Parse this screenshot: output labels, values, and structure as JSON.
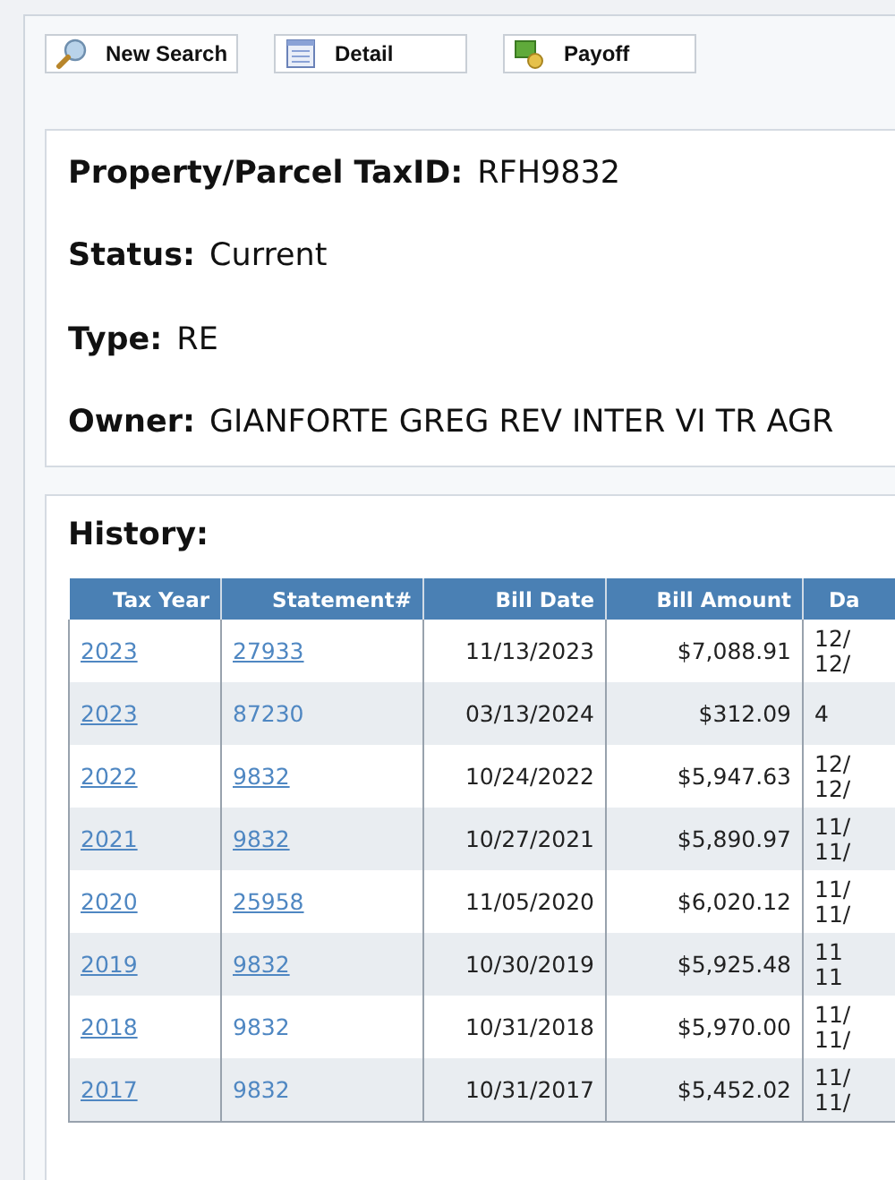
{
  "toolbar": [
    {
      "label": "New Search",
      "kind": "search"
    },
    {
      "label": "Detail",
      "kind": "detail"
    },
    {
      "label": "Payoff",
      "kind": "payoff"
    }
  ],
  "info": [
    {
      "label": "Property/Parcel TaxID:",
      "value": "RFH9832"
    },
    {
      "label": "Status:",
      "value": "Current"
    },
    {
      "label": "Type:",
      "value": "RE"
    },
    {
      "label": "Owner:",
      "value": "GIANFORTE GREG REV INTER VI TR AGR"
    }
  ],
  "history": {
    "title": "History:",
    "columns": [
      "Tax Year",
      "Statement#",
      "Bill Date",
      "Bill Amount",
      "Da"
    ],
    "rows": [
      {
        "tax_year": "2023",
        "statement": "27933",
        "statement_underlined": true,
        "bill_date": "11/13/2023",
        "bill_amount": "$7,088.91",
        "column_5": [
          "12/",
          "12/"
        ]
      },
      {
        "tax_year": "2023",
        "statement": "87230",
        "statement_underlined": false,
        "bill_date": "03/13/2024",
        "bill_amount": "$312.09",
        "column_5": [
          "4"
        ]
      },
      {
        "tax_year": "2022",
        "statement": "9832",
        "statement_underlined": true,
        "bill_date": "10/24/2022",
        "bill_amount": "$5,947.63",
        "column_5": [
          "12/",
          "12/"
        ]
      },
      {
        "tax_year": "2021",
        "statement": "9832",
        "statement_underlined": true,
        "bill_date": "10/27/2021",
        "bill_amount": "$5,890.97",
        "column_5": [
          "11/",
          "11/"
        ]
      },
      {
        "tax_year": "2020",
        "statement": "25958",
        "statement_underlined": true,
        "bill_date": "11/05/2020",
        "bill_amount": "$6,020.12",
        "column_5": [
          "11/",
          "11/"
        ]
      },
      {
        "tax_year": "2019",
        "statement": "9832",
        "statement_underlined": true,
        "bill_date": "10/30/2019",
        "bill_amount": "$5,925.48",
        "column_5": [
          "11",
          "11"
        ]
      },
      {
        "tax_year": "2018",
        "statement": "9832",
        "statement_underlined": false,
        "bill_date": "10/31/2018",
        "bill_amount": "$5,970.00",
        "column_5": [
          "11/",
          "11/"
        ]
      },
      {
        "tax_year": "2017",
        "statement": "9832",
        "statement_underlined": false,
        "bill_date": "10/31/2017",
        "bill_amount": "$5,452.02",
        "column_5": [
          "11/",
          "11/"
        ]
      }
    ]
  }
}
